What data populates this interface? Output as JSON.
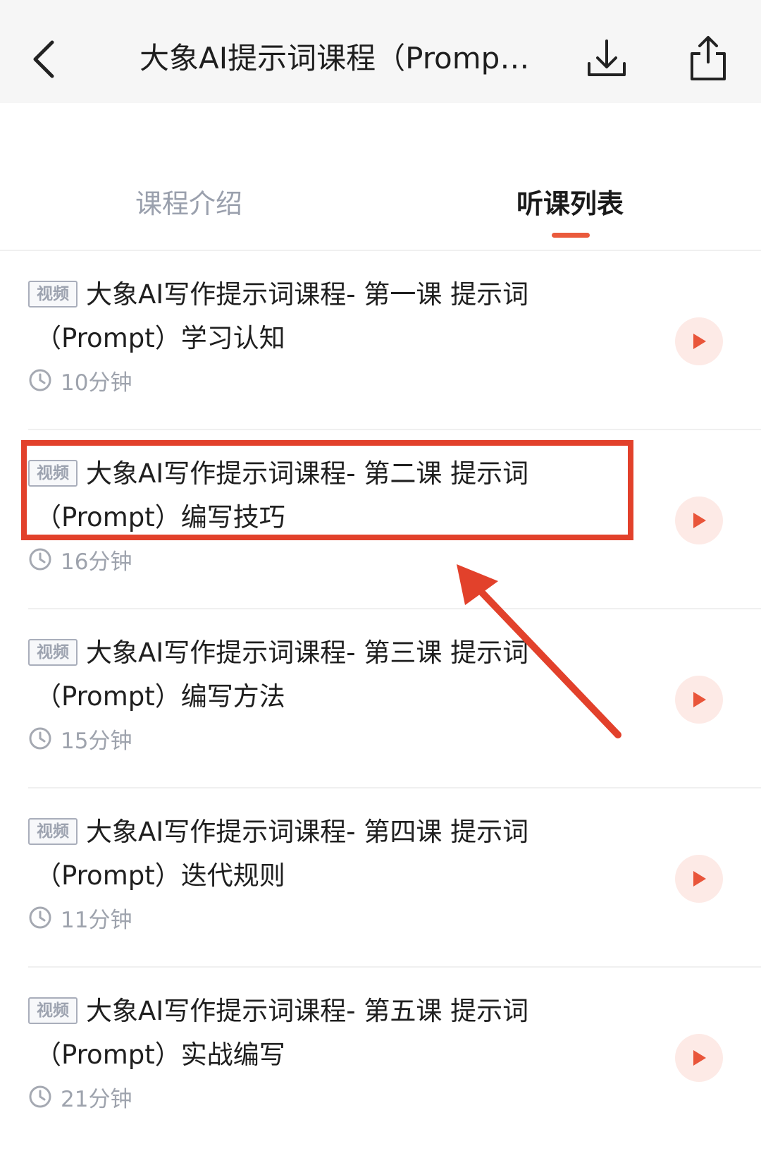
{
  "header": {
    "title": "大象AI提示词课程（Prompt）",
    "back_icon": "chevron-left-icon",
    "download_icon": "download-icon",
    "share_icon": "share-icon"
  },
  "tabs": [
    {
      "label": "课程介绍",
      "active": false
    },
    {
      "label": "听课列表",
      "active": true
    }
  ],
  "lessons": [
    {
      "badge": "视频",
      "title_line1": "大象AI写作提示词课程- 第一课  提示词",
      "title_line2": "（Prompt）学习认知",
      "duration": "10分钟"
    },
    {
      "badge": "视频",
      "title_line1": "大象AI写作提示词课程- 第二课  提示词",
      "title_line2": "（Prompt）编写技巧",
      "duration": "16分钟"
    },
    {
      "badge": "视频",
      "title_line1": "大象AI写作提示词课程- 第三课  提示词",
      "title_line2": "（Prompt）编写方法",
      "duration": "15分钟"
    },
    {
      "badge": "视频",
      "title_line1": "大象AI写作提示词课程- 第四课  提示词",
      "title_line2": "（Prompt）迭代规则",
      "duration": "11分钟"
    },
    {
      "badge": "视频",
      "title_line1": "大象AI写作提示词课程- 第五课  提示词",
      "title_line2": "（Prompt）实战编写",
      "duration": "21分钟"
    }
  ],
  "colors": {
    "accent": "#ea5a3c",
    "annotation": "#e2412b",
    "play_bg": "#fdeae6"
  }
}
